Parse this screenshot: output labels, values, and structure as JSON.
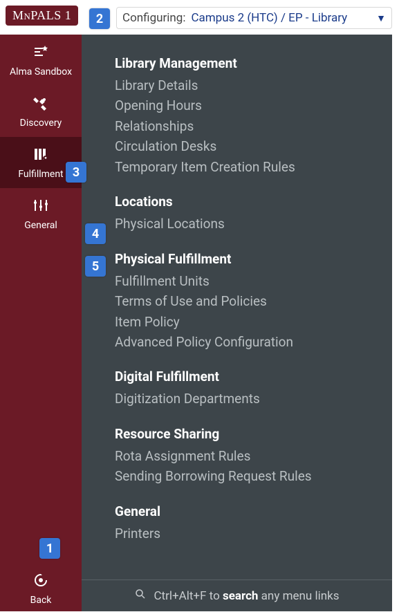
{
  "logo": "MnPALS 1",
  "config": {
    "label": "Configuring:",
    "value": "Campus 2 (HTC) / EP - Library"
  },
  "sidebar": {
    "items": [
      {
        "label": "Alma Sandbox"
      },
      {
        "label": "Discovery"
      },
      {
        "label": "Fulfillment"
      },
      {
        "label": "General"
      }
    ],
    "back_label": "Back"
  },
  "menu": {
    "sections": [
      {
        "title": "Library Management",
        "links": [
          "Library Details",
          "Opening Hours",
          "Relationships",
          "Circulation Desks",
          "Temporary Item Creation Rules"
        ]
      },
      {
        "title": "Locations",
        "links": [
          "Physical Locations"
        ]
      },
      {
        "title": "Physical Fulfillment",
        "links": [
          "Fulfillment Units",
          "Terms of Use and Policies",
          "Item Policy",
          "Advanced Policy Configuration"
        ]
      },
      {
        "title": "Digital Fulfillment",
        "links": [
          "Digitization Departments"
        ]
      },
      {
        "title": "Resource Sharing",
        "links": [
          "Rota Assignment Rules",
          "Sending Borrowing Request Rules"
        ]
      },
      {
        "title": "General",
        "links": [
          "Printers"
        ]
      }
    ]
  },
  "search": {
    "prefix": "Ctrl+Alt+F to ",
    "bold": "search",
    "suffix": " any menu links"
  },
  "badges": [
    "1",
    "2",
    "3",
    "4",
    "5"
  ]
}
